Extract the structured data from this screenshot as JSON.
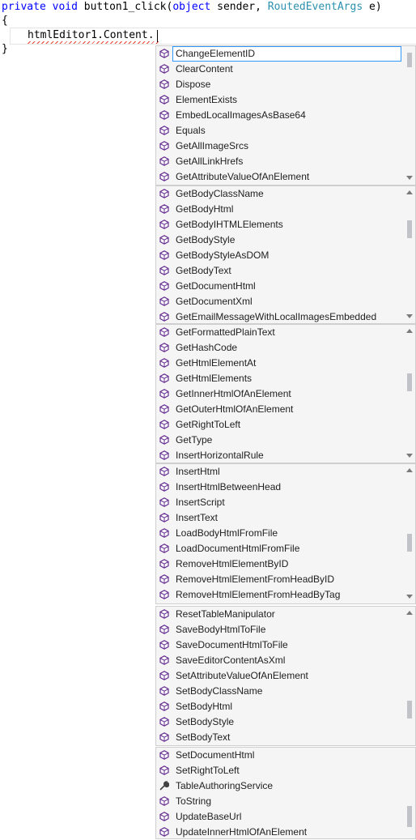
{
  "code": {
    "line1": {
      "kw1": "private",
      "kw2": "void",
      "method": "button1_click(",
      "kw3": "object",
      "param1": "sender,",
      "type": "RoutedEventArgs",
      "param2": "e)"
    },
    "line2": "{",
    "line3": "htmlEditor1.Content.",
    "line4": "}"
  },
  "completion": {
    "panels": [
      {
        "items": [
          "ChangeElementID",
          "ClearContent",
          "Dispose",
          "ElementExists",
          "EmbedLocalImagesAsBase64",
          "Equals",
          "GetAllImageSrcs",
          "GetAllLinkHrefs",
          "GetAttributeValueOfAnElement"
        ]
      },
      {
        "items": [
          "GetBodyClassName",
          "GetBodyHtml",
          "GetBodyIHTMLElements",
          "GetBodyStyle",
          "GetBodyStyleAsDOM",
          "GetBodyText",
          "GetDocumentHtml",
          "GetDocumentXml",
          "GetEmailMessageWithLocalImagesEmbedded"
        ]
      },
      {
        "items": [
          "GetFormattedPlainText",
          "GetHashCode",
          "GetHtmlElementAt",
          "GetHtmlElements",
          "GetInnerHtmlOfAnElement",
          "GetOuterHtmlOfAnElement",
          "GetRightToLeft",
          "GetType",
          "InsertHorizontalRule"
        ]
      },
      {
        "items": [
          "InsertHtml",
          "InsertHtmlBetweenHead",
          "InsertScript",
          "InsertText",
          "LoadBodyHtmlFromFile",
          "LoadDocumentHtmlFromFile",
          "RemoveHtmlElementByID",
          "RemoveHtmlElementFromHeadByID",
          "RemoveHtmlElementFromHeadByTag"
        ]
      },
      {
        "items": [
          "ResetTableManipulator",
          "SaveBodyHtmlToFile",
          "SaveDocumentHtmlToFile",
          "SaveEditorContentAsXml",
          "SetAttributeValueOfAnElement",
          "SetBodyClassName",
          "SetBodyHtml",
          "SetBodyStyle",
          "SetBodyText"
        ]
      },
      {
        "items": [
          "SetDocumentHtml",
          "SetRightToLeft",
          "TableAuthoringService",
          "ToString",
          "UpdateBaseUrl",
          "UpdateInnerHtmlOfAnElement"
        ]
      }
    ],
    "selected_item": "ChangeElementID",
    "property_item": "TableAuthoringService",
    "colors": {
      "method_icon": "#652d90",
      "property_icon": "#424242",
      "selection_border": "#3399ff"
    }
  }
}
